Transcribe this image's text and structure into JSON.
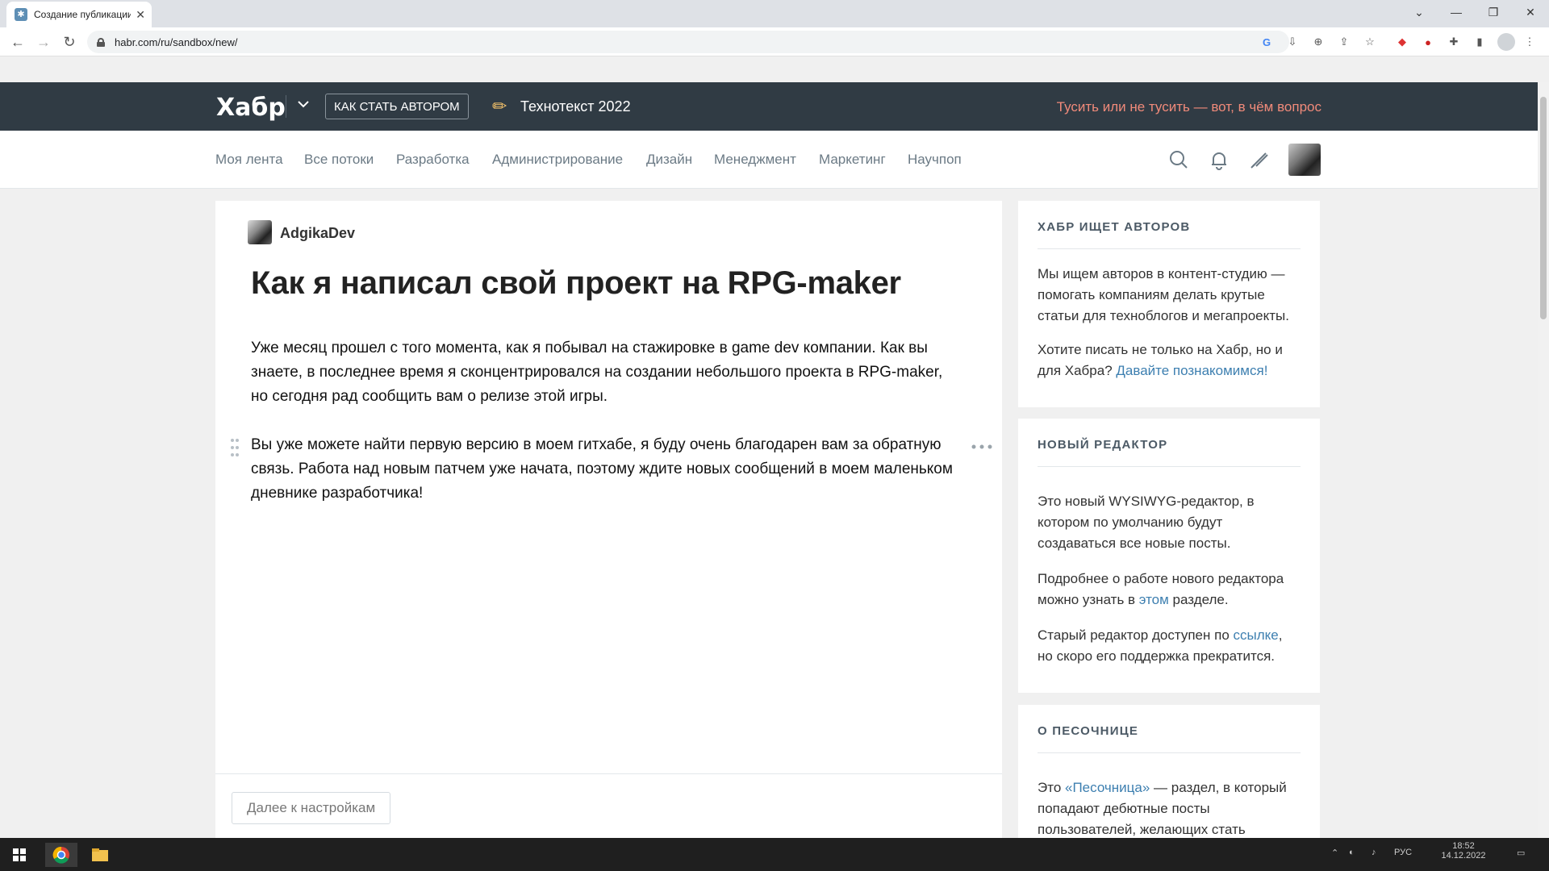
{
  "browser": {
    "tab_title": "Создание публикации",
    "url": "habr.com/ru/sandbox/new/"
  },
  "header": {
    "logo": "Хабр",
    "howto_label": "КАК СТАТЬ АВТОРОМ",
    "promo_title": "Технотекст 2022",
    "promo_right": "Тусить или не тусить — вот, в чём вопрос"
  },
  "nav": {
    "items": [
      "Моя лента",
      "Все потоки",
      "Разработка",
      "Администрирование",
      "Дизайн",
      "Менеджмент",
      "Маркетинг",
      "Научпоп"
    ]
  },
  "editor": {
    "author": "AdgikaDev",
    "title": "Как я написал свой проект на RPG-maker",
    "paragraphs": [
      "Уже месяц прошел с того момента, как я побывал на стажировке в game dev компании. Как вы знаете, в последнее время я сконцентрировался на создании небольшого проекта в RPG-maker, но сегодня рад сообщить вам о релизе этой игры.",
      "Вы уже можете найти первую версию в моем гитхабе, я буду очень благодарен вам за обратную связь. Работа над новым патчем уже начата, поэтому ждите новых сообщений в моем маленьком дневнике разработчика!"
    ],
    "next_button": "Далее к настройкам"
  },
  "sidebar": {
    "authors": {
      "heading": "ХАБР ИЩЕТ АВТОРОВ",
      "p1": "Мы ищем авторов в контент-студию — помогать компаниям делать крутые статьи для техноблогов и мегапроекты.",
      "p2_text": "Хотите писать не только на Хабр, но и для Хабра? ",
      "p2_link": "Давайте познакомимся!"
    },
    "editor_card": {
      "heading": "НОВЫЙ РЕДАКТОР",
      "p1": "Это новый WYSIWYG-редактор, в котором по умолчанию будут создаваться все новые посты.",
      "p2_text": "Подробнее о работе нового редактора можно узнать в ",
      "p2_link": "этом",
      "p2_tail": " разделе.",
      "p3_text": "Старый редактор доступен по ",
      "p3_link": "ссылке",
      "p3_tail": ", но скоро его поддержка прекратится."
    },
    "sandbox": {
      "heading": "О ПЕСОЧНИЦЕ",
      "p1_text": "Это ",
      "p1_link": "«Песочница»",
      "p1_tail": " — раздел, в который попадают дебютные посты пользователей, желающих стать"
    }
  },
  "taskbar": {
    "lang": "РУС",
    "time": "18:52",
    "date": "14.12.2022"
  }
}
